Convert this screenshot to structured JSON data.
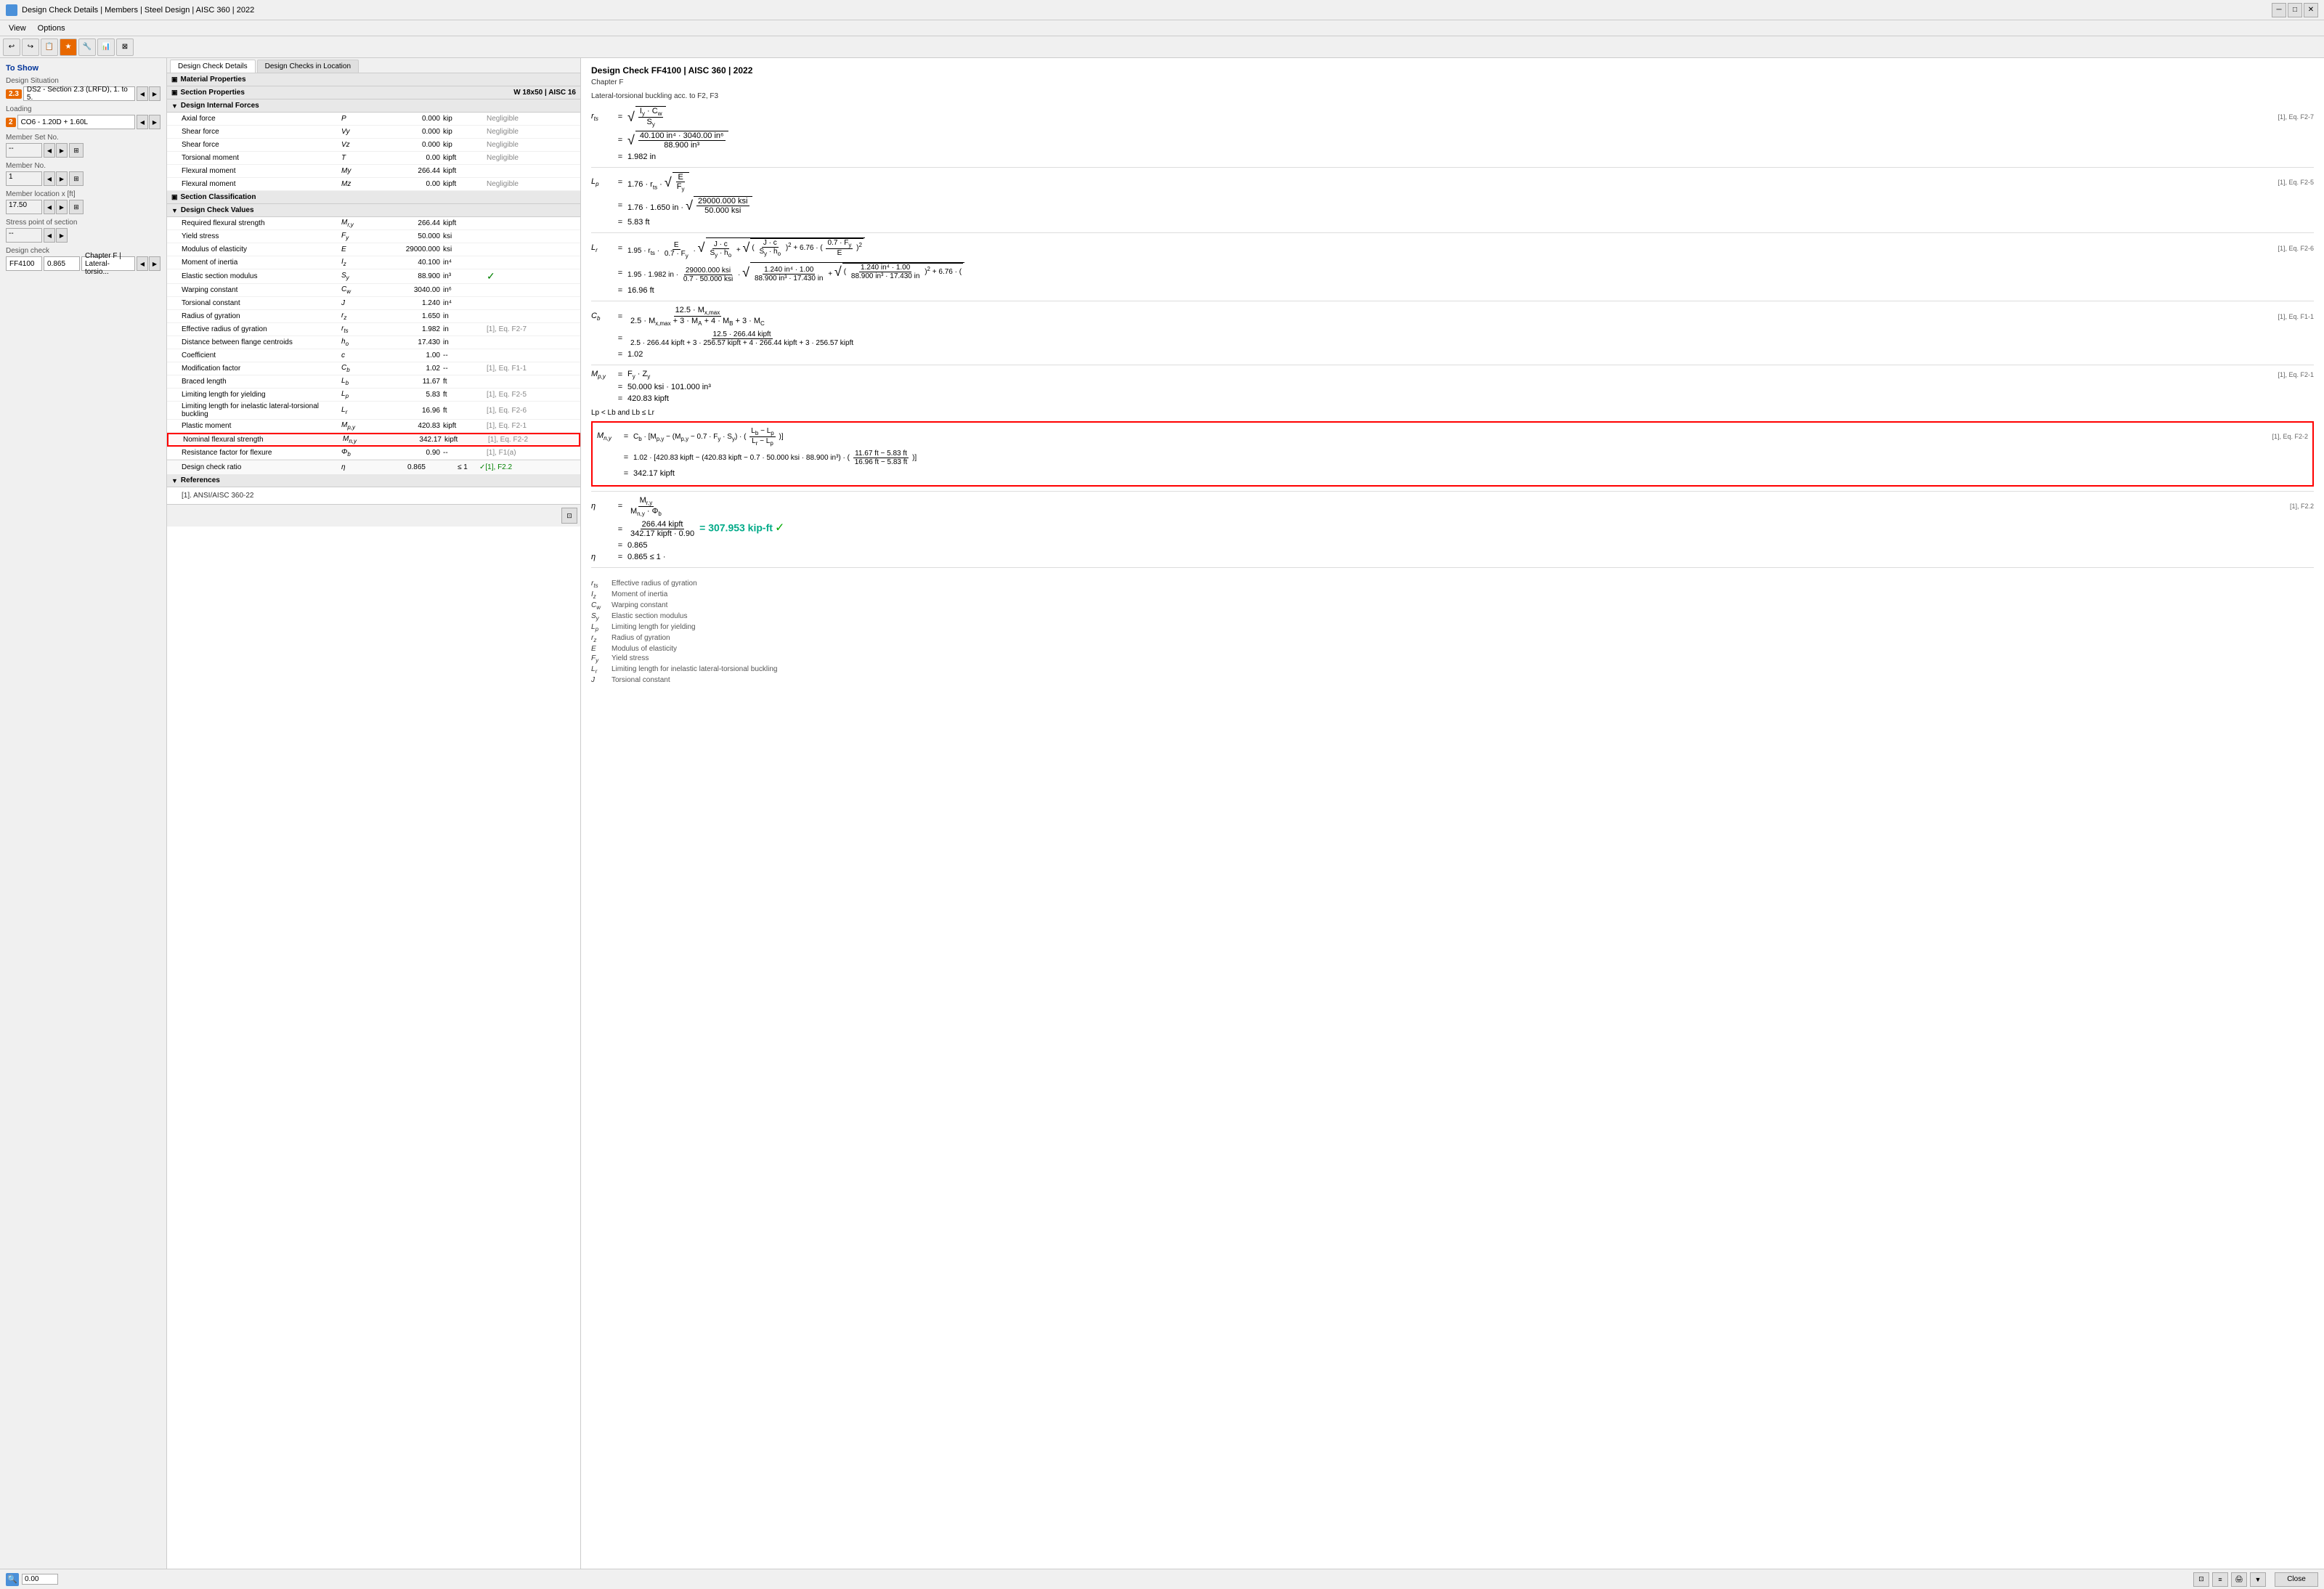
{
  "titleBar": {
    "title": "Design Check Details | Members | Steel Design | AISC 360 | 2022",
    "icon": "app-icon"
  },
  "menuBar": {
    "items": [
      "View",
      "Options"
    ]
  },
  "leftPanel": {
    "toShow": "To Show",
    "designSituation": {
      "label": "Design Situation",
      "badge": "2.3",
      "value": "DS2 - Section 2.3 (LRFD), 1. to 5."
    },
    "loading": {
      "label": "Loading",
      "badge": "2",
      "value": "CO6 - 1.20D + 1.60L"
    },
    "memberSetNo": {
      "label": "Member Set No.",
      "value": "--"
    },
    "memberNo": {
      "label": "Member No.",
      "value": "1"
    },
    "memberLocation": {
      "label": "Member location x [ft]",
      "value": "17.50"
    },
    "stressPoint": {
      "label": "Stress point of section",
      "value": "--"
    },
    "designCheck": {
      "label": "Design check",
      "value": "FF4100",
      "ratio": "0.865",
      "chapter": "Chapter F | Lateral-torsio..."
    }
  },
  "tabs": [
    "Design Check Details",
    "Design Checks in Location"
  ],
  "sections": {
    "materialProperties": "Material Properties",
    "sectionProperties": {
      "title": "Section Properties",
      "rightLabel": "W 18x50 | AISC 16"
    },
    "designInternalForces": {
      "title": "Design Internal Forces",
      "rows": [
        {
          "name": "Axial force",
          "symbol": "P",
          "value": "0.000",
          "unit": "kip",
          "note": "Negligible"
        },
        {
          "name": "Shear force",
          "symbol": "Vy",
          "value": "0.000",
          "unit": "kip",
          "note": "Negligible"
        },
        {
          "name": "Shear force",
          "symbol": "Vz",
          "value": "0.000",
          "unit": "kip",
          "note": "Negligible"
        },
        {
          "name": "Torsional moment",
          "symbol": "T",
          "value": "0.00",
          "unit": "kipft",
          "note": "Negligible"
        },
        {
          "name": "Flexural moment",
          "symbol": "My",
          "value": "266.44",
          "unit": "kipft",
          "note": ""
        },
        {
          "name": "Flexural moment",
          "symbol": "Mz",
          "value": "0.00",
          "unit": "kipft",
          "note": "Negligible"
        }
      ]
    },
    "sectionClassification": "Section Classification",
    "designCheckValues": {
      "title": "Design Check Values",
      "rows": [
        {
          "name": "Required flexural strength",
          "symbol": "Mrʸ",
          "value": "266.44",
          "unit": "kipft",
          "note": "",
          "ref": ""
        },
        {
          "name": "Yield stress",
          "symbol": "Fy",
          "value": "50.000",
          "unit": "ksi",
          "note": "",
          "ref": ""
        },
        {
          "name": "Modulus of elasticity",
          "symbol": "E",
          "value": "29000.000",
          "unit": "ksi",
          "note": "",
          "ref": ""
        },
        {
          "name": "Moment of inertia",
          "symbol": "Iz",
          "value": "40.100",
          "unit": "in⁴",
          "note": "",
          "ref": ""
        },
        {
          "name": "Elastic section modulus",
          "symbol": "Sy",
          "value": "88.900",
          "unit": "in³",
          "note": "",
          "ref": "",
          "check": true
        },
        {
          "name": "Warping constant",
          "symbol": "Cw",
          "value": "3040.00",
          "unit": "in⁶",
          "note": "",
          "ref": ""
        },
        {
          "name": "Torsional constant",
          "symbol": "J",
          "value": "1.240",
          "unit": "in⁴",
          "note": "",
          "ref": ""
        },
        {
          "name": "Radius of gyration",
          "symbol": "rz",
          "value": "1.650",
          "unit": "in",
          "note": "",
          "ref": ""
        },
        {
          "name": "Effective radius of gyration",
          "symbol": "rts",
          "value": "1.982",
          "unit": "in",
          "note": "[1], Eq. F2-7",
          "ref": "[1], Eq. F2-7"
        },
        {
          "name": "Distance between flange centroids",
          "symbol": "ho",
          "value": "17.430",
          "unit": "in",
          "note": "",
          "ref": ""
        },
        {
          "name": "Coefficient",
          "symbol": "c",
          "value": "1.00",
          "unit": "--",
          "note": "",
          "ref": ""
        },
        {
          "name": "Modification factor",
          "symbol": "Cb",
          "value": "1.02",
          "unit": "--",
          "note": "[1], Eq. F1-1",
          "ref": "[1], Eq. F1-1"
        },
        {
          "name": "Braced length",
          "symbol": "Lb",
          "value": "11.67",
          "unit": "ft",
          "note": "",
          "ref": ""
        },
        {
          "name": "Limiting length for yielding",
          "symbol": "Lp",
          "value": "5.83",
          "unit": "ft",
          "note": "[1], Eq. F2-5",
          "ref": "[1], Eq. F2-5"
        },
        {
          "name": "Limiting length for inelastic lateral-torsional buckling",
          "symbol": "Lr",
          "value": "16.96",
          "unit": "ft",
          "note": "[1], Eq. F2-6",
          "ref": "[1], Eq. F2-6"
        },
        {
          "name": "Plastic moment",
          "symbol": "Mpʸ",
          "value": "420.83",
          "unit": "kipft",
          "note": "[1], Eq. F2-1",
          "ref": "[1], Eq. F2-1"
        },
        {
          "name": "Nominal flexural strength",
          "symbol": "Mnʸ",
          "value": "342.17",
          "unit": "kipft",
          "note": "[1], Eq. F2-2",
          "ref": "[1], Eq. F2-2",
          "highlighted": true
        },
        {
          "name": "Resistance factor for flexure",
          "symbol": "Φb",
          "value": "0.90",
          "unit": "--",
          "note": "[1], F1(a)",
          "ref": "[1], F1(a)"
        }
      ]
    },
    "designCheckRatio": {
      "label": "Design check ratio",
      "symbol": "η",
      "value": "0.865",
      "unit": "--",
      "limit": "≤ 1",
      "ref": "[1], F2.2",
      "passed": true
    },
    "references": {
      "title": "References",
      "items": [
        "[1]. ANSI/AISC 360-22"
      ]
    }
  },
  "rightPanel": {
    "title": "Design Check FF4100 | AISC 360 | 2022",
    "subtitle1": "Chapter F",
    "subtitle2": "Lateral-torsional buckling acc. to F2, F3",
    "formulas": {
      "rts_label": "rts",
      "rts_eq_ref": "[1], Eq. F2-7",
      "rts_sqrt_num": "√(Iy · Cw)",
      "rts_sqrt_den": "Sy",
      "rts_num_val": "40.100 in⁴ · 3040.00 in⁶",
      "rts_den_val": "88.900 in³",
      "rts_result": "1.982 in",
      "lp_label": "Lp",
      "lp_ref": "[1], Eq. F2-5",
      "lp_formula": "1.76 · rts · √(E / Fy)",
      "lp_val1": "1.76 · 1.650 in · √(29000.000 ksi / 50.000 ksi)",
      "lp_result": "5.83 ft",
      "lr_label": "Lr",
      "lr_ref": "[1], Eq. F2-6",
      "lr_formula": "1.95 · rts · (E / (0.7 · Fy)) · √(J·c/(Sy·ho) + √((J·c/(Sy·ho))² + 6.76·(0.7·Fy/E)²))",
      "lr_result": "16.96 ft",
      "cb_label": "Cb",
      "cb_ref": "[1], Eq. F1-1",
      "cb_formula": "12.5 · Mx,max / (2.5 · Mx,max + 3 · MA + 4 · MB + 3 · MC)",
      "cb_num": "12.5 · 266.44 kipft",
      "cb_den": "2.5 · 266.44 kipft + 3 · 256.57 kipft + 4 · 266.44 kipft + 3 · 256.57 kipft",
      "cb_result": "1.02",
      "mpy_label": "Mpʸ",
      "mpy_ref": "[1], Eq. F2-1",
      "mpy_formula": "Fy · Zy",
      "mpy_val": "50.000 ksi · 101.000 in³",
      "mpy_result": "420.83 kipft",
      "condition": "Lp < Lb and Lb ≤ Lr",
      "mny_label": "Mnʸ",
      "mny_ref": "[1], Eq. F2-2",
      "mny_formula": "Cb · [Mpʸ - (Mpʸ - 0.7 · Fy · Sy) · ((Lb - Lp)/(Lr - Lp))]",
      "mny_val": "1.02 · [420.83 kipft - (420.83 kipft - 0.7 · 50.000 ksi · 88.900 in³) · ((11.67 ft - 5.83 ft)/(16.96 ft - 5.83 ft))]",
      "mny_result": "342.17 kipft",
      "eta_label": "η",
      "eta_ref": "[1], F2.2",
      "eta_formula": "Mrʸ / (Mnʸ · Φb)",
      "eta_val": "266.44 kipft / (342.17 kipft · 0.90)",
      "eta_teal": "= 307.953 kip-ft",
      "eta_result": "0.865",
      "eta_check": "0.865 ≤ 1 ·"
    },
    "legend": [
      {
        "sym": "rts",
        "desc": "Effective radius of gyration"
      },
      {
        "sym": "Iz",
        "desc": "Moment of inertia"
      },
      {
        "sym": "Cw",
        "desc": "Warping constant"
      },
      {
        "sym": "Sy",
        "desc": "Elastic section modulus"
      },
      {
        "sym": "Lp",
        "desc": "Limiting length for yielding"
      },
      {
        "sym": "rz",
        "desc": "Radius of gyration"
      },
      {
        "sym": "E",
        "desc": "Modulus of elasticity"
      },
      {
        "sym": "Fy",
        "desc": "Yield stress"
      },
      {
        "sym": "Lr",
        "desc": "Limiting length for inelastic lateral-torsional buckling"
      },
      {
        "sym": "J",
        "desc": "Torsional constant"
      }
    ]
  },
  "statusBar": {
    "leftIcon": "search-icon",
    "rightValue": "0.00"
  },
  "bottomBar": {
    "closeLabel": "Close"
  }
}
